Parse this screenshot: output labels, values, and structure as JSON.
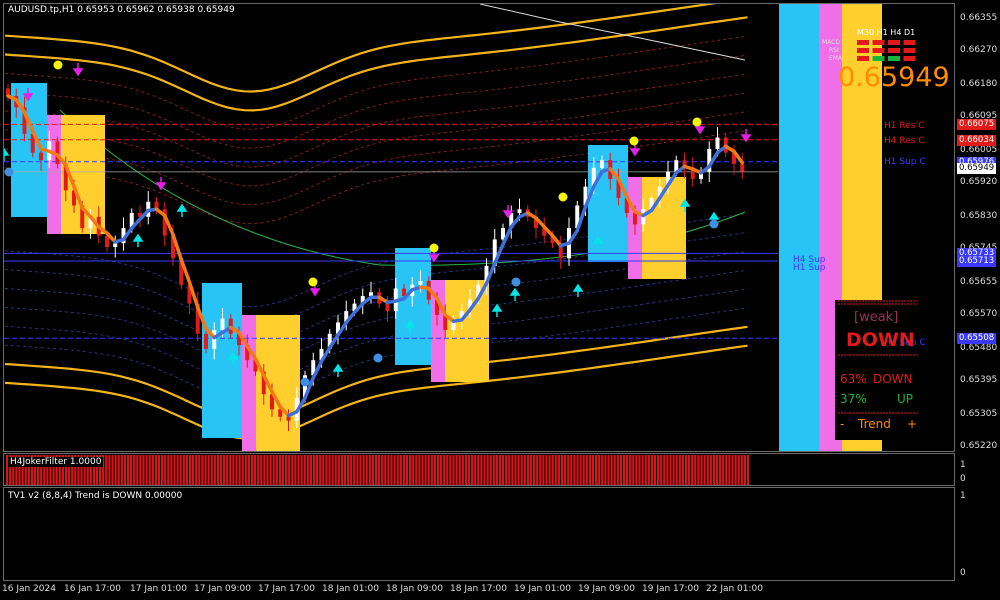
{
  "header": {
    "symbol_line": "AUDUSD.tp,H1  0.65953 0.65962 0.65938 0.65949"
  },
  "chart_data": {
    "type": "candlestick",
    "symbol": "AUDUSD.tp",
    "timeframe": "H1",
    "ohlc_header": {
      "open": 0.65953,
      "high": 0.65962,
      "low": 0.65938,
      "close": 0.65949
    },
    "last_price": 0.65949,
    "ylim": [
      0.6522,
      0.6637
    ],
    "price_axis_labels": [
      "0.66355",
      "0.66270",
      "0.66180",
      "0.66095",
      "0.66005",
      "0.65920",
      "0.65830",
      "0.65745",
      "0.65655",
      "0.65570",
      "0.65480",
      "0.65395",
      "0.65305",
      "0.65220"
    ],
    "time_axis_labels": [
      "16 Jan 2024",
      "16 Jan 17:00",
      "17 Jan 01:00",
      "17 Jan 09:00",
      "17 Jan 17:00",
      "18 Jan 01:00",
      "18 Jan 09:00",
      "18 Jan 17:00",
      "19 Jan 01:00",
      "19 Jan 09:00",
      "19 Jan 17:00",
      "22 Jan 01:00"
    ],
    "close_series": [
      0.6615,
      0.6612,
      0.6605,
      0.66,
      0.6598,
      0.6603,
      0.6597,
      0.659,
      0.6586,
      0.658,
      0.6583,
      0.6578,
      0.6575,
      0.6576,
      0.658,
      0.6584,
      0.6583,
      0.6587,
      0.6585,
      0.6578,
      0.6572,
      0.6565,
      0.656,
      0.6552,
      0.6548,
      0.6553,
      0.6556,
      0.6552,
      0.6549,
      0.6545,
      0.6542,
      0.6536,
      0.6532,
      0.653,
      0.6529,
      0.6535,
      0.6541,
      0.6545,
      0.6548,
      0.6552,
      0.6555,
      0.6558,
      0.656,
      0.6562,
      0.6563,
      0.656,
      0.6558,
      0.6564,
      0.6562,
      0.6565,
      0.6566,
      0.6561,
      0.6557,
      0.6553,
      0.6556,
      0.6558,
      0.6561,
      0.6565,
      0.657,
      0.6577,
      0.658,
      0.6584,
      0.6585,
      0.6583,
      0.658,
      0.6578,
      0.6576,
      0.6572,
      0.658,
      0.6586,
      0.6591,
      0.6596,
      0.6598,
      0.6593,
      0.6588,
      0.6584,
      0.6581,
      0.6585,
      0.6588,
      0.6591,
      0.6595,
      0.6598,
      0.6596,
      0.6593,
      0.6595,
      0.6601,
      0.6604,
      0.66,
      0.6597,
      0.6595
    ],
    "levels": [
      {
        "name": "H1 Res C",
        "price": 0.66075,
        "label": "0.66075",
        "color": "#e31a1a"
      },
      {
        "name": "H4 Res C",
        "price": 0.66034,
        "label": "0.66034",
        "color": "#e31a1a"
      },
      {
        "name": "H1 Sup C",
        "price": 0.65976,
        "label": "0.65976",
        "color": "#3a3aff"
      },
      {
        "name": "H4 Sup",
        "price": 0.65733,
        "label": "0.65733",
        "color": "#3a3aff"
      },
      {
        "name": "H1 Sup",
        "price": 0.65713,
        "label": "0.65713",
        "color": "#3a3aff"
      },
      {
        "name": "H4 Sup C",
        "price": 0.65508,
        "label": "0.65508",
        "color": "#3a3aff"
      }
    ]
  },
  "dashboard": {
    "tf_headers": [
      "M30",
      "H1",
      "H4",
      "D1"
    ],
    "row_labels": [
      "MACD",
      "RSI",
      "EMA"
    ],
    "big_price": "0.65949",
    "weak_label": "[weak]",
    "direction": "DOWN",
    "down_pct": "63%",
    "down_word": "DOWN",
    "up_pct": "37%",
    "up_word": "UP",
    "trend_left": "-",
    "trend_word": "Trend",
    "trend_right": "+"
  },
  "indicators": {
    "joker": {
      "title": "H4JokerFilter 1.0000",
      "axis_top": "1",
      "axis_bottom": "0"
    },
    "tv1": {
      "title": "TV1 v2 (8,8,4) Trend is DOWN 0.00000",
      "axis_top": "1",
      "axis_bottom": "0"
    }
  },
  "colors": {
    "background": "#000000",
    "bull_candle": "#ffffff",
    "bear_candle": "#e31a1a",
    "resistance": "#e31a1a",
    "support": "#3a3aff",
    "box_cyan": "#29c4f6",
    "box_pink": "#f06ee8",
    "box_yellow": "#ffcf2e",
    "trend_blue": "#3f6fd8",
    "trend_orange": "#f07a16",
    "band_outer": "#f5b41a",
    "histogram": "#d6141a",
    "big_price": "#ff8c00"
  }
}
